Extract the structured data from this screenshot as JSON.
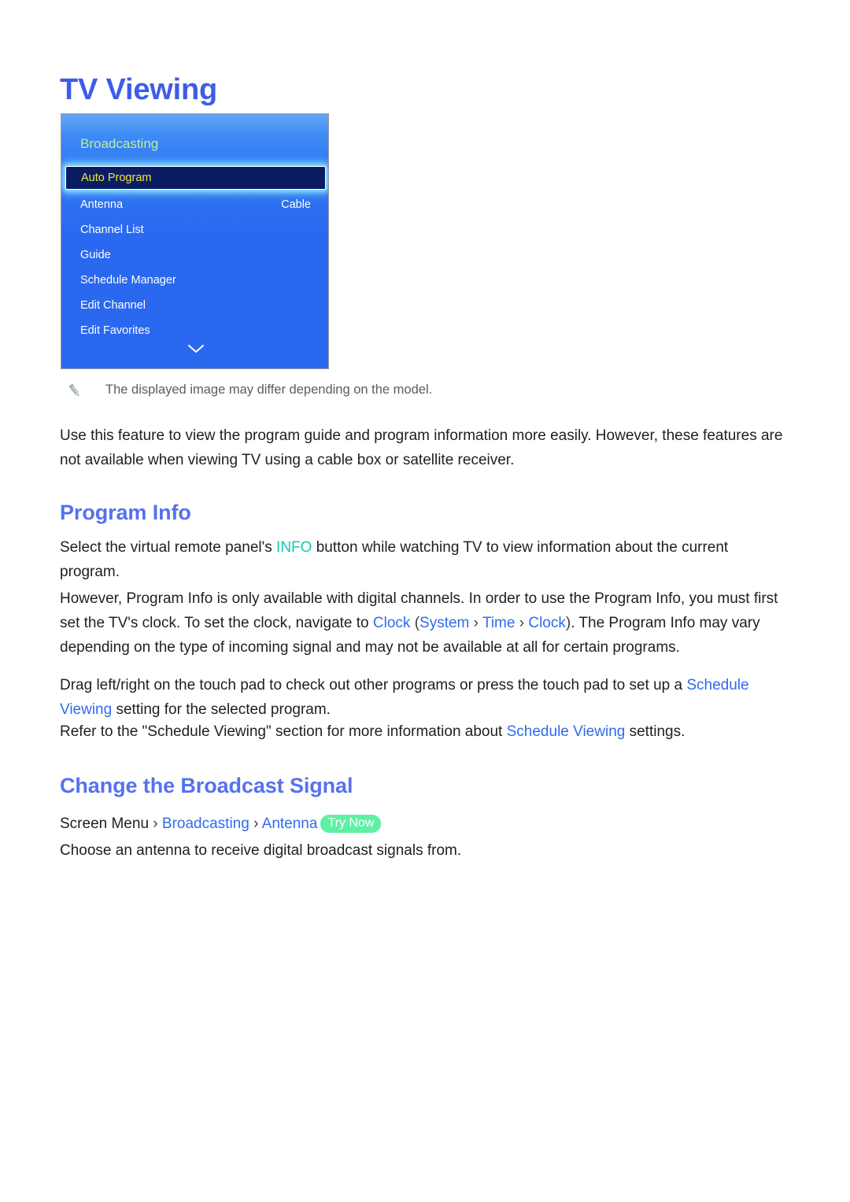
{
  "page": {
    "title": "TV Viewing"
  },
  "tv_menu": {
    "header": "Broadcasting",
    "items": [
      {
        "label": "Auto Program",
        "value": "",
        "selected": true
      },
      {
        "label": "Antenna",
        "value": "Cable",
        "selected": false
      },
      {
        "label": "Channel List",
        "value": "",
        "selected": false
      },
      {
        "label": "Guide",
        "value": "",
        "selected": false
      },
      {
        "label": "Schedule Manager",
        "value": "",
        "selected": false
      },
      {
        "label": "Edit Channel",
        "value": "",
        "selected": false
      },
      {
        "label": "Edit Favorites",
        "value": "",
        "selected": false
      }
    ],
    "scroll_indicator": "chevron-down-icon",
    "colors": {
      "background_top": "#63a6f7",
      "background_bottom": "#2a68ef",
      "header_text": "#b9f09b",
      "selected_fill": "#0a1d63",
      "selected_text": "#f2e33c",
      "glow": "#96ebff"
    }
  },
  "note": {
    "icon": "pencil-icon",
    "text": "The displayed image may differ depending on the model."
  },
  "intro_paragraph": "Use this feature to view the program guide and program information more easily. However, these features are not available when viewing TV using a cable box or satellite receiver.",
  "sections": [
    {
      "heading": "Program Info",
      "paragraphs": {
        "p1_a": "Select the virtual remote panel's ",
        "p1_highlight": "INFO",
        "p1_b": " button while watching TV to view information about the current program.",
        "p2_a": "However, Program Info is only available with digital channels. In order to use the Program Info, you must first set the TV's clock. To set the clock, navigate to ",
        "p2_link1": "Clock",
        "p2_paren_open": " (",
        "p2_link2": "System",
        "p2_sep1": " › ",
        "p2_link3": "Time",
        "p2_sep2": " › ",
        "p2_link4": "Clock",
        "p2_paren_close": ")",
        "p2_b": ". The Program Info may vary depending on the type of incoming signal and may not be available at all for certain programs.",
        "p3_a": "Drag left/right on the touch pad to check out other programs or press the touch pad to set up a ",
        "p3_link": "Schedule Viewing",
        "p3_b": " setting for the selected program.",
        "p4_a": "Refer to the \"Schedule Viewing\" section for more information about ",
        "p4_link": "Schedule Viewing",
        "p4_b": " settings."
      }
    },
    {
      "heading": "Change the Broadcast Signal",
      "menu_path": {
        "root": "Screen Menu",
        "sep1": " › ",
        "level1": "Broadcasting",
        "sep2": " › ",
        "level2": "Antenna",
        "badge": "Try Now"
      },
      "paragraph": "Choose an antenna to receive digital broadcast signals from."
    }
  ],
  "colors": {
    "heading_primary": "#3d5ce8",
    "heading_secondary": "#5671ee",
    "link_blue": "#2f6bec",
    "highlight_teal": "#14c7b4",
    "badge_green": "#5ef0a4"
  }
}
